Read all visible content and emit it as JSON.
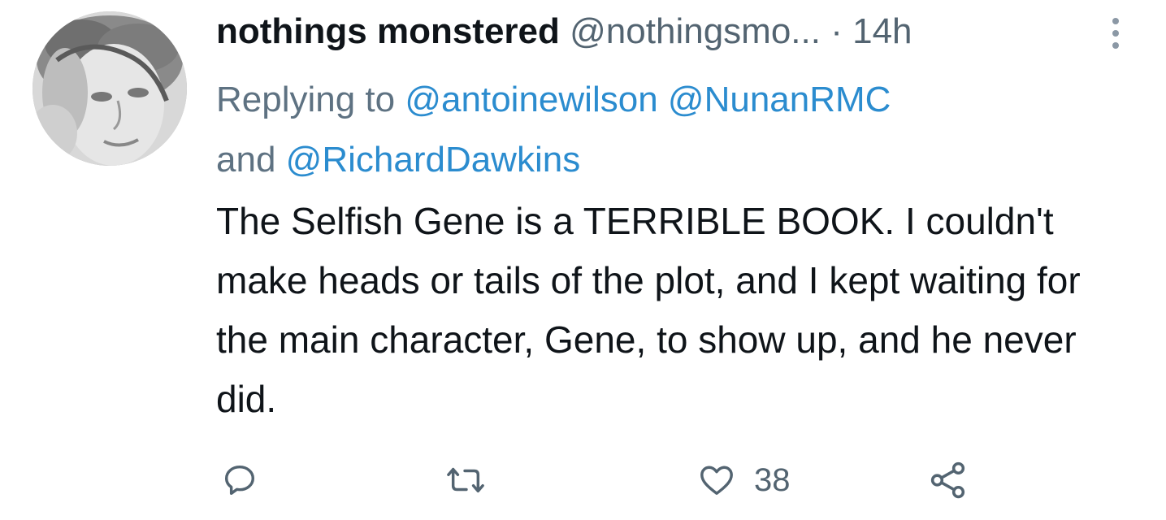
{
  "tweet": {
    "author": {
      "display_name": "nothings monstered",
      "handle": "@nothingsmo...",
      "avatar_icon": "profile-photo"
    },
    "separator": "·",
    "timestamp": "14h",
    "more_icon": "more-vertical-icon",
    "reply_context": {
      "prefix": "Replying to",
      "mentions": [
        "@antoinewilson",
        "@NunanRMC",
        "@RichardDawkins"
      ],
      "conjunction": "and"
    },
    "text": "The Selfish Gene is a TERRIBLE BOOK. I couldn't make heads or tails of the plot, and I kept waiting for the main character, Gene, to show up, and he never did.",
    "actions": {
      "reply_icon": "reply-icon",
      "retweet_icon": "retweet-icon",
      "like_icon": "heart-icon",
      "like_count": "38",
      "share_icon": "share-icon"
    },
    "colors": {
      "mention": "#2b8ccf",
      "muted": "#536471",
      "text": "#0f1419"
    }
  }
}
